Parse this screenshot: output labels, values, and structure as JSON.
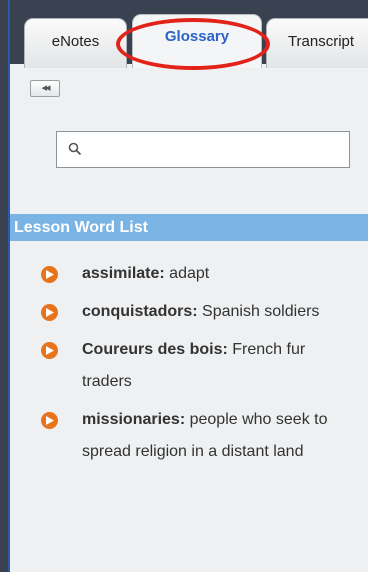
{
  "tabs": [
    {
      "label": "eNotes",
      "active": false
    },
    {
      "label": "Glossary",
      "active": true
    },
    {
      "label": "Transcript",
      "active": false
    }
  ],
  "toolbar": {
    "collapse_icon": "double-chevron-left-icon",
    "collapse_glyph": "◂◂"
  },
  "search": {
    "placeholder": "",
    "value": "",
    "icon": "search-icon"
  },
  "glossary": {
    "header": "Lesson Word List",
    "items": [
      {
        "term": "assimilate:",
        "definition": "adapt"
      },
      {
        "term": "conquistadors:",
        "definition": "Spanish soldiers"
      },
      {
        "term": "Coureurs des bois:",
        "definition": "French fur traders"
      },
      {
        "term": "missionaries:",
        "definition": "people who seek to spread religion in a distant land"
      }
    ]
  },
  "colors": {
    "accent": "#2b63c6",
    "header_bg": "#7ab4e5",
    "bullet": "#e8731d",
    "highlight": "#e2231a"
  }
}
